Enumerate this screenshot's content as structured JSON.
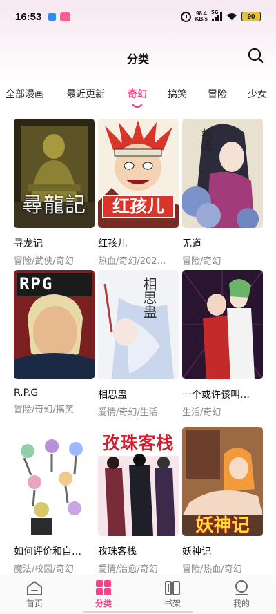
{
  "status_bar": {
    "time": "16:53",
    "net_speed_value": "98.4",
    "net_speed_unit": "KB/s",
    "signal": "5G",
    "battery": "90"
  },
  "header": {
    "title": "分类"
  },
  "tabs": [
    {
      "label": "全部漫画",
      "active": false
    },
    {
      "label": "最近更新",
      "active": false
    },
    {
      "label": "奇幻",
      "active": true
    },
    {
      "label": "搞笑",
      "active": false
    },
    {
      "label": "冒险",
      "active": false
    },
    {
      "label": "少女",
      "active": false
    }
  ],
  "comics": [
    {
      "title": "寻龙记",
      "tags": "冒险/武侠/奇幻",
      "cover_text": "尋龍記"
    },
    {
      "title": "红孩儿",
      "tags": "热血/奇幻/202…",
      "cover_text": "红孩儿"
    },
    {
      "title": "无道",
      "tags": "冒险/奇幻",
      "cover_text": "無道"
    },
    {
      "title": "R.P.G",
      "tags": "冒险/奇幻/搞笑",
      "cover_text": "RPG"
    },
    {
      "title": "相思蛊",
      "tags": "爱情/奇幻/生活",
      "cover_text": "相思蛊"
    },
    {
      "title": "一个或许该叫…",
      "tags": "生活/奇幻",
      "cover_text": ""
    },
    {
      "title": "如何评价和自…",
      "tags": "魔法/校园/奇幻",
      "cover_text": ""
    },
    {
      "title": "孜珠客栈",
      "tags": "爱情/治愈/奇幻",
      "cover_text": "孜珠客栈"
    },
    {
      "title": "妖神记",
      "tags": "冒险/热血/奇幻",
      "cover_text": "妖神记"
    }
  ],
  "bottom_nav": [
    {
      "label": "首页",
      "icon": "home-icon",
      "active": false
    },
    {
      "label": "分类",
      "icon": "grid-icon",
      "active": true
    },
    {
      "label": "书架",
      "icon": "bookshelf-icon",
      "active": false
    },
    {
      "label": "我的",
      "icon": "profile-icon",
      "active": false
    }
  ],
  "colors": {
    "accent": "#ff3d8a"
  }
}
